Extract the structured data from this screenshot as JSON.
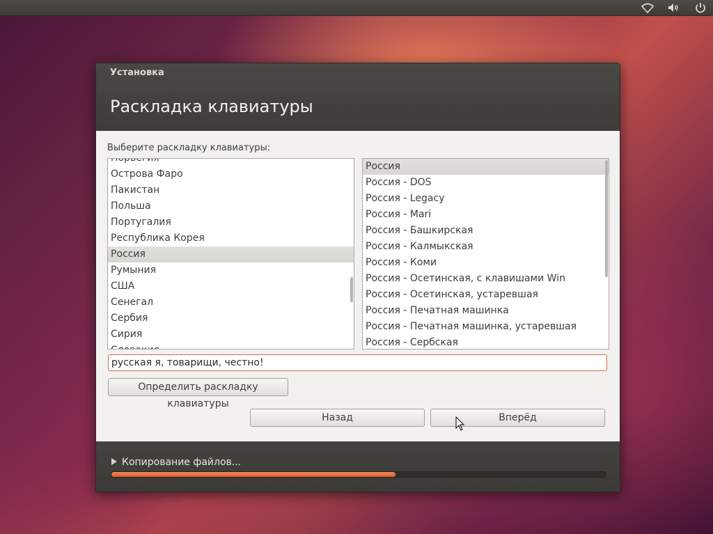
{
  "window": {
    "title": "Установка"
  },
  "page": {
    "title": "Раскладка клавиатуры",
    "prompt": "Выберите раскладку клавиатуры:"
  },
  "countries": {
    "items": [
      "Норвегия",
      "Острова Фаро",
      "Пакистан",
      "Польша",
      "Португалия",
      "Республика Корея",
      "Россия",
      "Румыния",
      "США",
      "Сенегал",
      "Сербия",
      "Сирия",
      "Словакия"
    ],
    "selected": "Россия"
  },
  "variants": {
    "items": [
      "Россия",
      "Россия - DOS",
      "Россия - Legacy",
      "Россия - Mari",
      "Россия - Башкирская",
      "Россия - Калмыкская",
      "Россия - Коми",
      "Россия - Осетинская, с клавишами Win",
      "Россия - Осетинская, устаревшая",
      "Россия - Печатная машинка",
      "Россия - Печатная машинка, устаревшая",
      "Россия - Сербская"
    ],
    "selected": "Россия"
  },
  "test_input": {
    "value": "русская я, товарищи, честно!"
  },
  "buttons": {
    "detect": "Определить раскладку клавиатуры",
    "back": "Назад",
    "forward": "Вперёд"
  },
  "footer": {
    "status": "Копирование файлов...",
    "progress": 0.575
  },
  "tray": {
    "icons": [
      "wifi-icon",
      "volume-icon",
      "power-icon"
    ]
  },
  "colors": {
    "accent": "#df5a2a",
    "input_border": "#e0693a",
    "header_bg": "#3d3c38"
  }
}
